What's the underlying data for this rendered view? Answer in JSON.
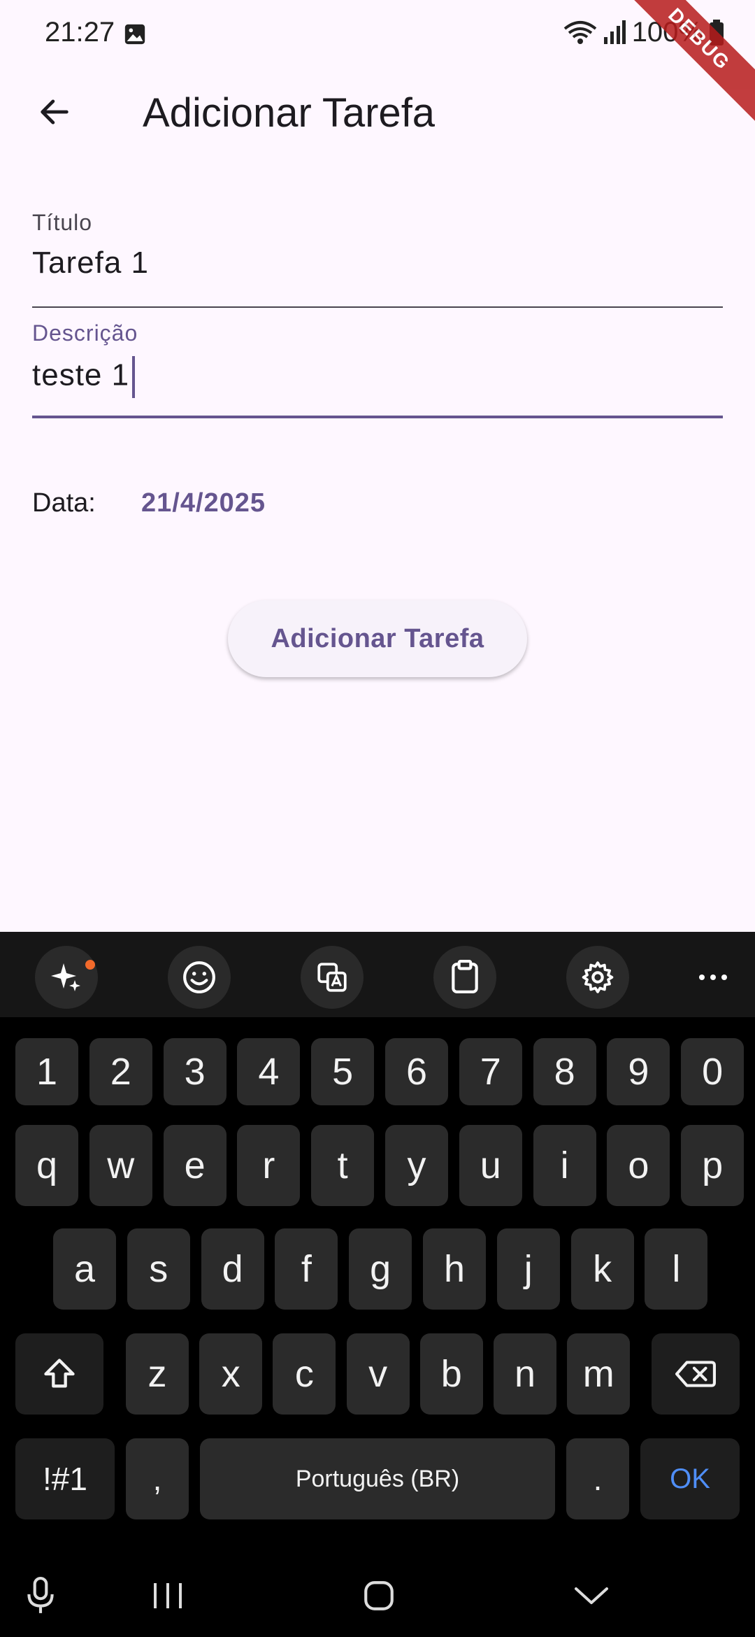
{
  "status_bar": {
    "time": "21:27",
    "battery": "100%",
    "debug_banner": "DEBUG"
  },
  "app_bar": {
    "title": "Adicionar Tarefa"
  },
  "form": {
    "title_field": {
      "label": "Título",
      "value": "Tarefa 1"
    },
    "description_field": {
      "label": "Descrição",
      "value": "teste 1"
    },
    "date": {
      "label": "Data:",
      "value": "21/4/2025"
    },
    "submit_label": "Adicionar Tarefa"
  },
  "colors": {
    "accent": "#65558f",
    "background": "#fef7ff",
    "keyboard_bg": "#000000",
    "key_bg": "#2b2b2b",
    "ok_blue": "#4f8ef7"
  },
  "keyboard": {
    "toolbar_icons": [
      "ai-sparkle-icon",
      "emoji-icon",
      "translate-icon",
      "clipboard-icon",
      "settings-icon",
      "more-icon"
    ],
    "row_numbers": [
      "1",
      "2",
      "3",
      "4",
      "5",
      "6",
      "7",
      "8",
      "9",
      "0"
    ],
    "row_top": [
      "q",
      "w",
      "e",
      "r",
      "t",
      "y",
      "u",
      "i",
      "o",
      "p"
    ],
    "row_middle": [
      "a",
      "s",
      "d",
      "f",
      "g",
      "h",
      "j",
      "k",
      "l"
    ],
    "row_bottom": [
      "z",
      "x",
      "c",
      "v",
      "b",
      "n",
      "m"
    ],
    "symbols_label": "!#1",
    "comma_label": ",",
    "space_label": "Português (BR)",
    "period_label": ".",
    "ok_label": "OK"
  },
  "nav_bar": {
    "icons": [
      "mic-icon",
      "recent-apps-icon",
      "home-icon",
      "hide-keyboard-icon"
    ]
  }
}
